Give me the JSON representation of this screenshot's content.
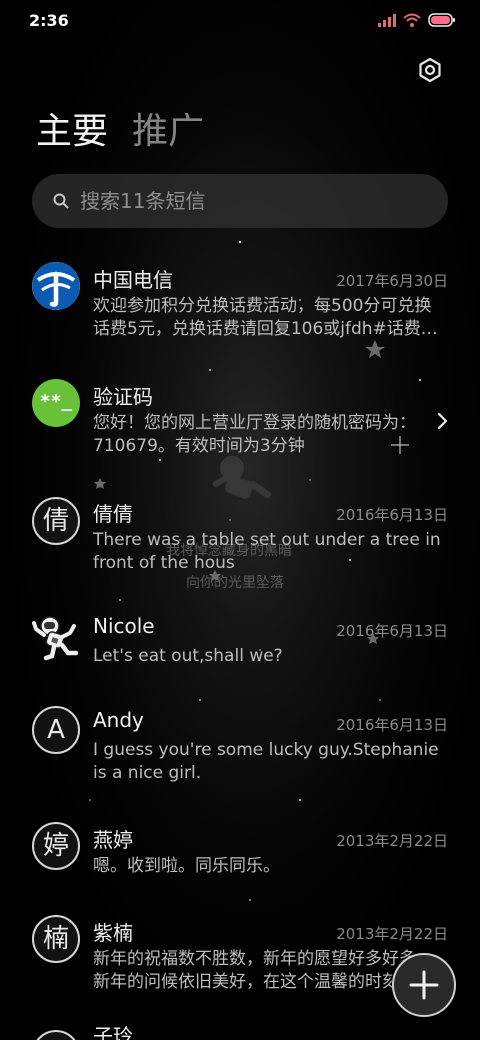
{
  "status_bar": {
    "time": "2:36",
    "icons": [
      "signal-icon",
      "wifi-icon",
      "battery-icon"
    ],
    "battery_color": "#ff6b8a"
  },
  "header": {
    "settings_icon": "settings-icon",
    "tabs": [
      {
        "label": "主要",
        "active": true
      },
      {
        "label": "推广",
        "active": false
      }
    ]
  },
  "search": {
    "placeholder": "搜索11条短信",
    "value": ""
  },
  "background_text": {
    "line1": "我将悼念藏身的黑暗",
    "line2": "向你的光里坠落"
  },
  "conversations": [
    {
      "name": "中国电信",
      "date": "2017年6月30日",
      "preview": "欢迎参加积分兑换话费活动，每500分可兑换话费5元，兑换话费请回复106或jfdh#话费…",
      "avatar_type": "telecom-logo"
    },
    {
      "name": "验证码",
      "date": "",
      "preview": "您好！您的网上营业厅登录的随机密码为：710679。有效时间为3分钟",
      "avatar_type": "code",
      "avatar_text": "**_",
      "avatar_color": "#67c23a",
      "has_chevron": true
    },
    {
      "name": "倩倩",
      "date": "2016年6月13日",
      "preview": "There was a table set out under a tree in front of the hous",
      "avatar_type": "letter",
      "avatar_text": "倩"
    },
    {
      "name": "Nicole",
      "date": "2016年6月13日",
      "preview": "Let's eat out,shall we?",
      "avatar_type": "astronaut"
    },
    {
      "name": "Andy",
      "date": "2016年6月13日",
      "preview": "I guess you're some lucky guy.Stephanie is a nice girl.",
      "avatar_type": "letter",
      "avatar_text": "A"
    },
    {
      "name": "燕婷",
      "date": "2013年2月22日",
      "preview": "嗯。收到啦。同乐同乐。",
      "avatar_type": "letter",
      "avatar_text": "婷"
    },
    {
      "name": "紫楠",
      "date": "2013年2月22日",
      "preview": "新年的祝福数不胜数，新年的愿望好多好多，新年的问候依旧美好，在这个温馨的时刻",
      "avatar_type": "letter",
      "avatar_text": "楠"
    },
    {
      "name": "子玲",
      "date": "",
      "preview": "",
      "avatar_type": "letter",
      "avatar_text": ""
    }
  ],
  "fab": {
    "icon": "plus-icon"
  }
}
